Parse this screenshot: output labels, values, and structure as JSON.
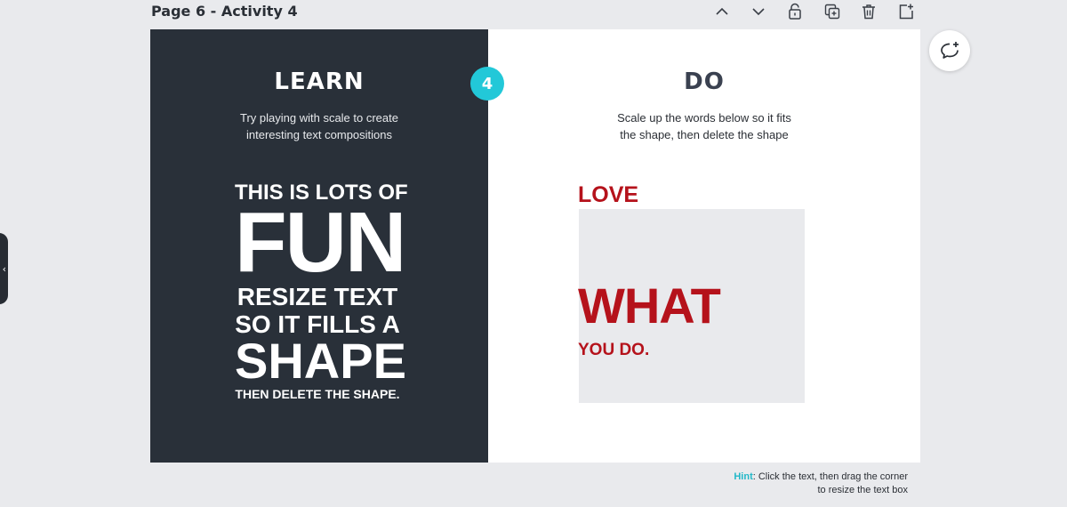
{
  "page_header": {
    "title": "Page 6 - Activity 4",
    "icons": [
      "chevron-up-icon",
      "chevron-down-icon",
      "unlock-icon",
      "duplicate-icon",
      "trash-icon",
      "add-page-icon"
    ]
  },
  "learn": {
    "title": "LEARN",
    "description_line1": "Try playing with scale to create",
    "description_line2": "interesting text compositions",
    "poster": {
      "line1": "THIS IS LOTS OF",
      "line2": "FUN",
      "line3": "RESIZE TEXT",
      "line4": "SO IT FILLS A",
      "line5": "SHAPE",
      "line6": "THEN DELETE THE SHAPE."
    }
  },
  "step_badge": "4",
  "do": {
    "title": "DO",
    "description_line1": "Scale up the words below so it fits",
    "description_line2": "the shape, then delete the shape",
    "words": {
      "love": "LOVE",
      "what": "WHAT",
      "you_do": "YOU DO."
    }
  },
  "hint": {
    "label": "Hint",
    "line1": ": Click the text, then drag the corner",
    "line2": "to resize the text box"
  },
  "colors": {
    "learn_background": "#293039",
    "badge": "#22c8d8",
    "accent_red": "#b5121b",
    "shape_fill": "#e9eaed",
    "hint_label": "#22b8c8"
  },
  "side_tab_icon": "chevron-left-icon",
  "comment_icon": "add-comment-icon"
}
